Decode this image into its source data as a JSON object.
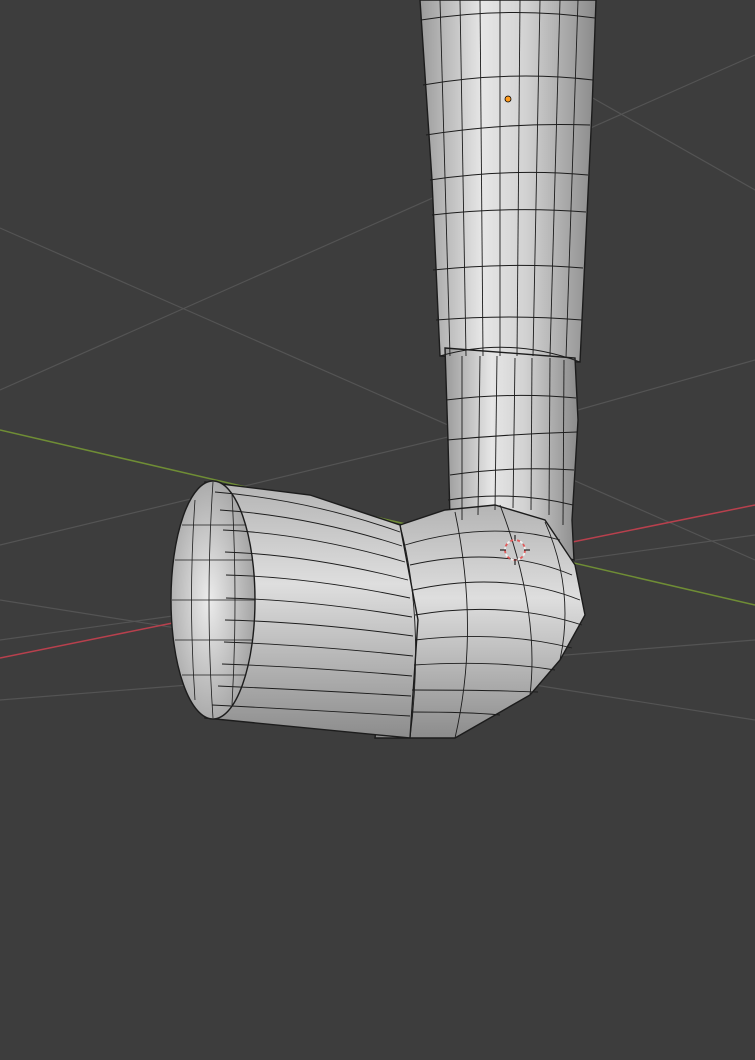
{
  "app": "3D Viewport",
  "colors": {
    "background": "#3d3d3d",
    "grid_line": "#545454",
    "axis_x": "#b8404d",
    "axis_y": "#6f8d35",
    "mesh_fill": "#cfcfcf",
    "wire": "#1c1c1c",
    "origin": "#ff9c1f",
    "cursor_red": "#e05a5a",
    "cursor_white": "#f2f2f2"
  },
  "icons": {
    "object_origin": "origin-dot-icon",
    "cursor_3d": "3d-cursor-icon"
  }
}
